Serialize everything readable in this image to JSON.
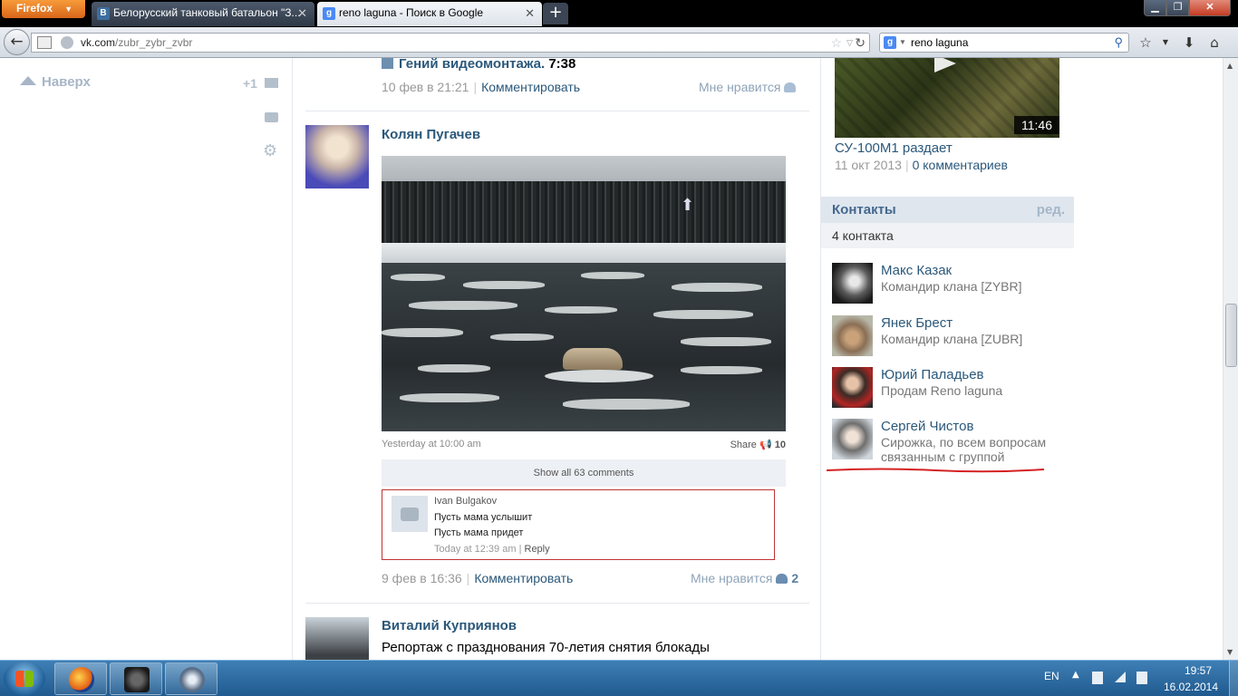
{
  "browser": {
    "menu_label": "Firefox",
    "tabs": [
      {
        "title": "Белорусский танковый батальон \"З...",
        "favicon": "В"
      },
      {
        "title": "reno laguna - Поиск в Google",
        "favicon": "g"
      }
    ],
    "new_tab_label": "+",
    "url_host": "vk.com",
    "url_path": "/zubr_zybr_zvbr",
    "search_value": "reno laguna",
    "window_controls": {
      "minimize": "▁",
      "maximize": "❐",
      "close": "✕"
    }
  },
  "left": {
    "to_top_label": "Наверх",
    "plus_one": "+1"
  },
  "feed": {
    "posts": [
      {
        "video_title": "Гений видеомонтажа.",
        "video_duration": "7:38",
        "date": "10 фев в 21:21",
        "comment_link": "Комментировать",
        "like_label": "Мне нравится"
      },
      {
        "author": "Колян Пугачев",
        "photo_caption_date": "Yesterday at 10:00 am",
        "photo_share": "Share",
        "photo_share_count": "10",
        "show_comments": "Show all 63 comments",
        "comment": {
          "name": "Ivan Bulgakov",
          "line1": "Пусть мама услышит",
          "line2": "Пусть мама придет",
          "time": "Today at 12:39 am",
          "reply": "Reply"
        },
        "date": "9 фев в 16:36",
        "comment_link": "Комментировать",
        "like_label": "Мне нравится",
        "like_count": "2"
      },
      {
        "author": "Виталий Куприянов",
        "text": "Репортаж с празднования 70-летия снятия блокады"
      }
    ]
  },
  "right": {
    "video": {
      "duration": "11:46",
      "title": "СУ-100М1 раздает",
      "date": "11 окт 2013",
      "comments": "0 комментариев"
    },
    "contacts": {
      "title": "Контакты",
      "edit": "ред.",
      "count": "4 контакта",
      "items": [
        {
          "name": "Макс Казак",
          "desc": "Командир клана [ZYBR]"
        },
        {
          "name": "Янек Брест",
          "desc": "Командир клана [ZUBR]"
        },
        {
          "name": "Юрий Паладьев",
          "desc": "Продам Reno laguna"
        },
        {
          "name": "Сергей Чистов",
          "desc": "Сирожка, по всем вопросам связанным с группой"
        }
      ]
    }
  },
  "taskbar": {
    "lang": "EN",
    "time": "19:57",
    "date": "16.02.2014"
  },
  "colors": {
    "link": "#2b587a",
    "contacts_header_bg": "#dfe6ee",
    "highlight_border": "#c03333"
  }
}
